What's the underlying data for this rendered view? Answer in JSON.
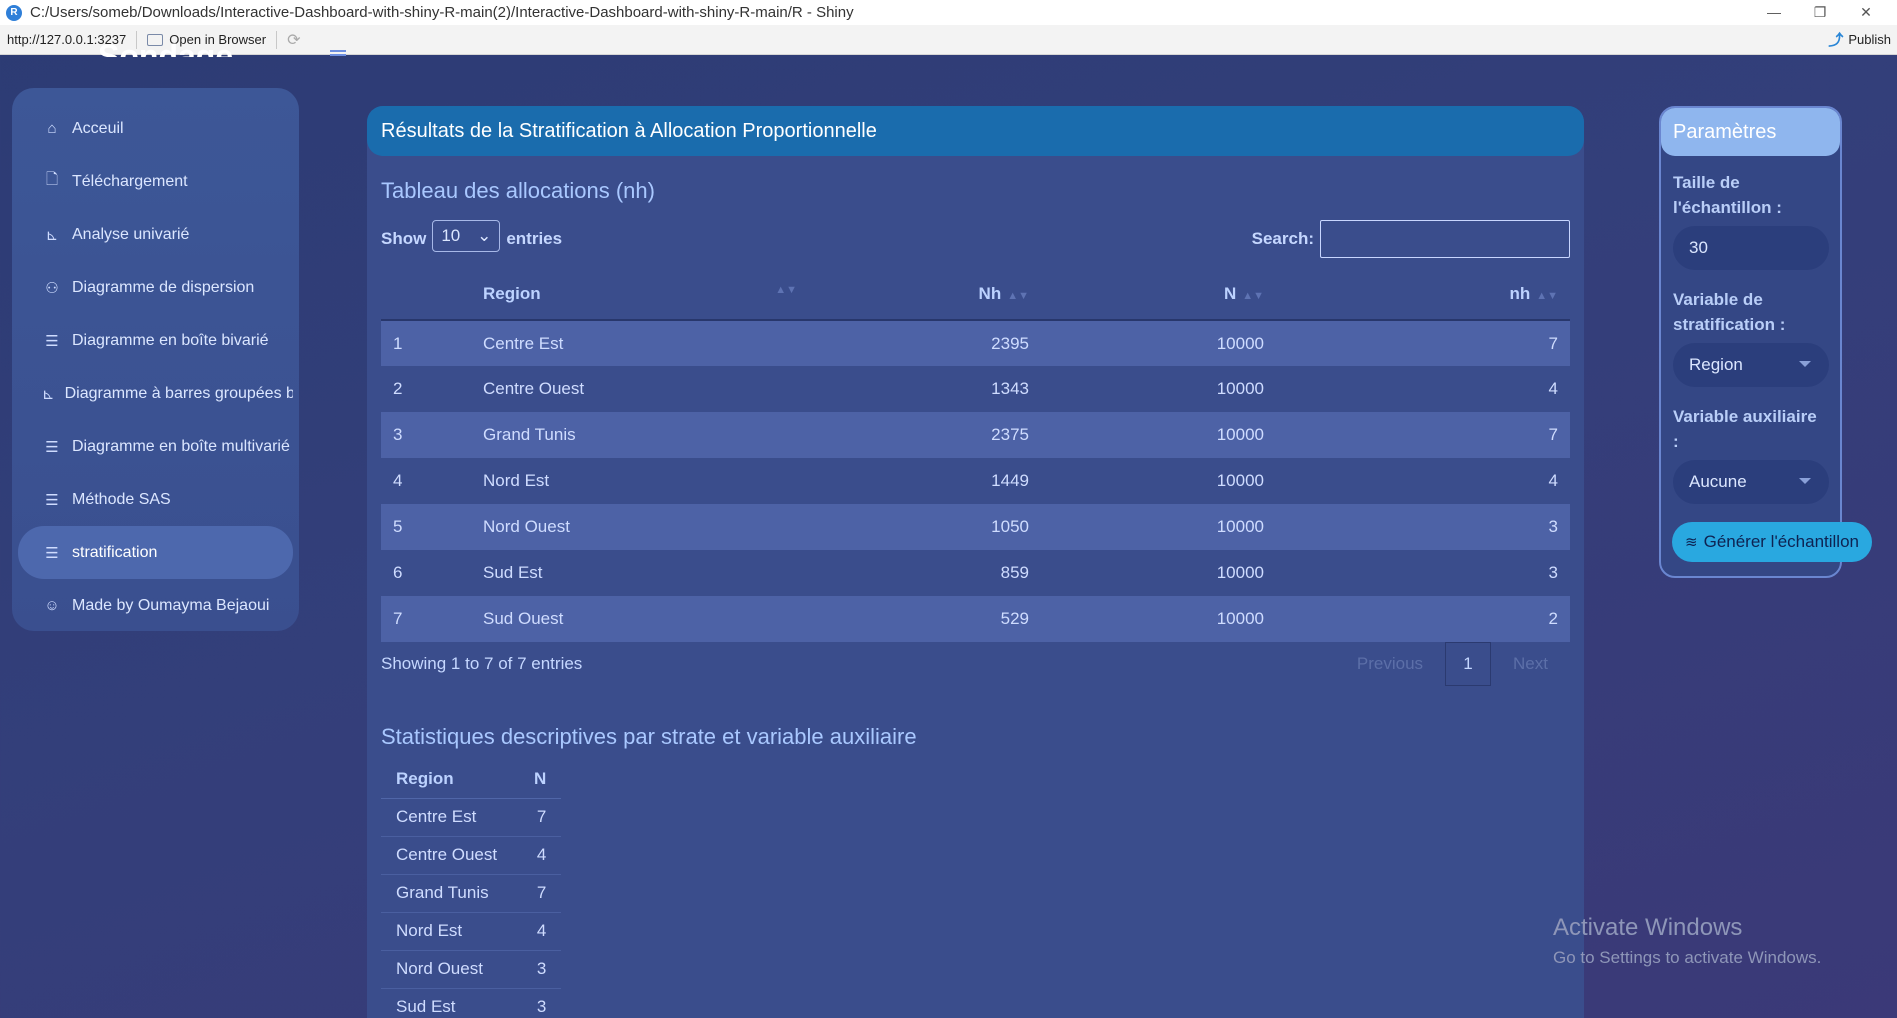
{
  "window": {
    "title": "C:/Users/someb/Downloads/Interactive-Dashboard-with-shiny-R-main(2)/Interactive-Dashboard-with-shiny-R-main/R - Shiny",
    "app_icon": "R",
    "minimize": "—",
    "restore": "❐",
    "close": "✕"
  },
  "addressbar": {
    "url": "http://127.0.0.1:3237",
    "open_in_browser": "Open in Browser",
    "refresh_icon": "⟳",
    "publish_icon": "⤴",
    "publish": "Publish"
  },
  "brand": {
    "title": "Sondage",
    "toggle_icon": "hamburger-icon"
  },
  "sidebar": {
    "items": [
      {
        "icon": "⌂",
        "label": "Acceuil"
      },
      {
        "icon": "🗋",
        "label": "Téléchargement"
      },
      {
        "icon": "⊾",
        "label": "Analyse univarié"
      },
      {
        "icon": "⚇",
        "label": "Diagramme de dispersion"
      },
      {
        "icon": "☰",
        "label": "Diagramme en boîte bivarié"
      },
      {
        "icon": "⊾",
        "label": "Diagramme à barres groupées bi"
      },
      {
        "icon": "☰",
        "label": "Diagramme en boîte multivarié"
      },
      {
        "icon": "☰",
        "label": "Méthode SAS"
      },
      {
        "icon": "☰",
        "label": "stratification",
        "active": true
      },
      {
        "icon": "☺",
        "label": "Made by Oumayma Bejaoui"
      }
    ]
  },
  "main": {
    "header": "Résultats de la Stratification à Allocation Proportionnelle",
    "table_title": "Tableau des allocations (nh)",
    "show_label": "Show",
    "entries_label": "entries",
    "page_length": "10",
    "search_label": "Search:",
    "search_value": "",
    "sort_icon": "▲▼",
    "columns": [
      "",
      "Region",
      "Nh",
      "N",
      "nh"
    ],
    "rows": [
      [
        "1",
        "Centre Est",
        "2395",
        "10000",
        "7"
      ],
      [
        "2",
        "Centre Ouest",
        "1343",
        "10000",
        "4"
      ],
      [
        "3",
        "Grand Tunis",
        "2375",
        "10000",
        "7"
      ],
      [
        "4",
        "Nord Est",
        "1449",
        "10000",
        "4"
      ],
      [
        "5",
        "Nord Ouest",
        "1050",
        "10000",
        "3"
      ],
      [
        "6",
        "Sud Est",
        "859",
        "10000",
        "3"
      ],
      [
        "7",
        "Sud Ouest",
        "529",
        "10000",
        "2"
      ]
    ],
    "info": "Showing 1 to 7 of 7 entries",
    "previous": "Previous",
    "current_page": "1",
    "next": "Next",
    "stats_title": "Statistiques descriptives par strate et variable auxiliaire",
    "stats_columns": [
      "Region",
      "N"
    ],
    "stats_rows": [
      [
        "Centre Est",
        "7"
      ],
      [
        "Centre Ouest",
        "4"
      ],
      [
        "Grand Tunis",
        "7"
      ],
      [
        "Nord Est",
        "4"
      ],
      [
        "Nord Ouest",
        "3"
      ],
      [
        "Sud Est",
        "3"
      ]
    ]
  },
  "params": {
    "title": "Paramètres",
    "sample_size_label_1": "Taille de",
    "sample_size_label_2": "l'échantillon :",
    "sample_size_value": "30",
    "strat_var_label_1": "Variable de",
    "strat_var_label_2": "stratification :",
    "strat_var_value": "Region",
    "aux_var_label_1": "Variable auxiliaire",
    "aux_var_label_2": ":",
    "aux_var_value": "Aucune",
    "generate_icon": "≋",
    "generate": "Générer l'échantillon"
  },
  "watermark": {
    "line1": "Activate Windows",
    "line2": "Go to Settings to activate Windows."
  },
  "colors": {
    "background": "#323f79",
    "sidebar": "#3d5797",
    "header": "#1a6cad",
    "accent_button": "#29a8e0",
    "params_header": "#8fb6ee"
  }
}
